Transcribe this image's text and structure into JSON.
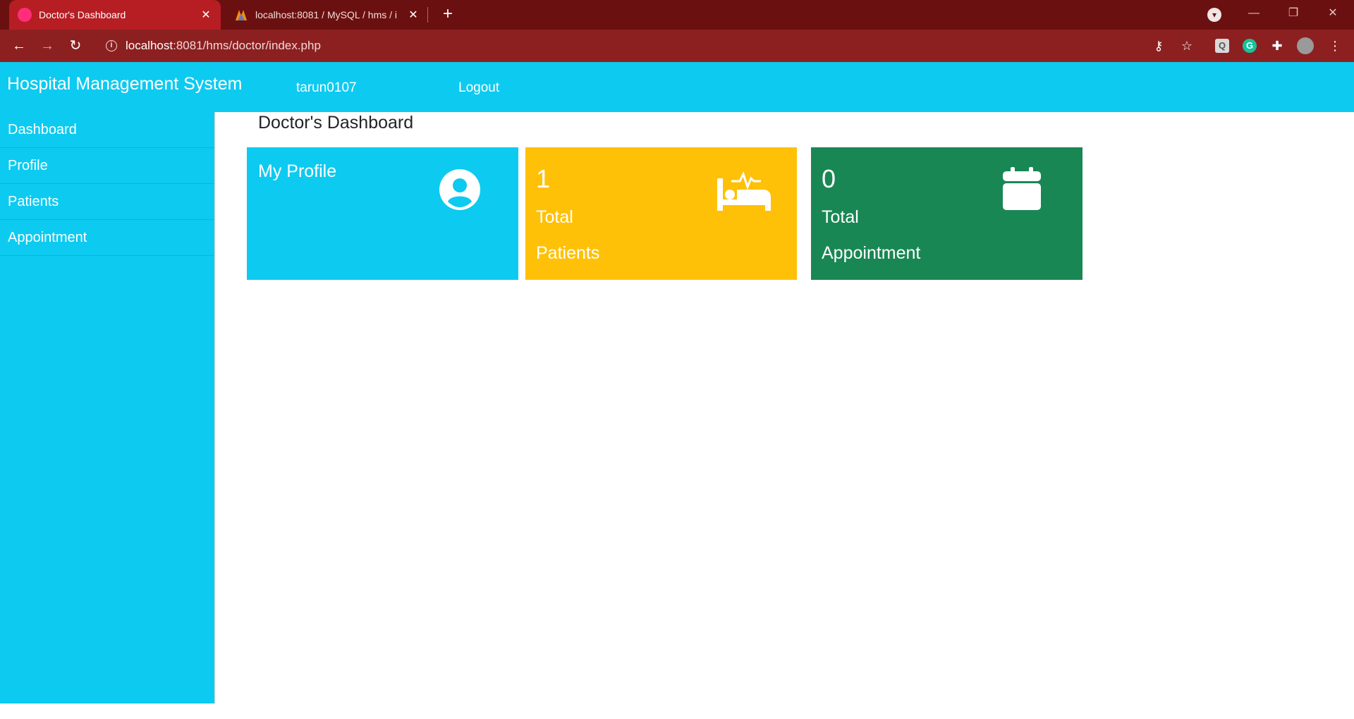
{
  "browser": {
    "tabs": [
      {
        "title": "Doctor's Dashboard",
        "active": true
      },
      {
        "title": "localhost:8081 / MySQL / hms / i",
        "active": false
      }
    ],
    "url_host": "localhost",
    "url_rest": ":8081/hms/doctor/index.php",
    "tab_bg": "#6b1010",
    "toolbar_bg": "#8c2020"
  },
  "navbar": {
    "brand": "Hospital Management System",
    "username": "tarun0107",
    "logout": "Logout",
    "color": "#0dcaf0"
  },
  "sidebar": {
    "items": [
      {
        "label": "Dashboard"
      },
      {
        "label": "Profile"
      },
      {
        "label": "Patients"
      },
      {
        "label": "Appointment"
      }
    ]
  },
  "main": {
    "title": "Doctor's Dashboard",
    "cards": {
      "profile": {
        "title": "My Profile",
        "icon": "user-circle-icon",
        "color": "#0dcaf0"
      },
      "patients": {
        "count": "1",
        "line1": "Total",
        "line2": "Patients",
        "icon": "hospital-bed-icon",
        "color": "#ffc107"
      },
      "appointment": {
        "count": "0",
        "line1": "Total",
        "line2": "Appointment",
        "icon": "calendar-icon",
        "color": "#198754"
      }
    }
  }
}
